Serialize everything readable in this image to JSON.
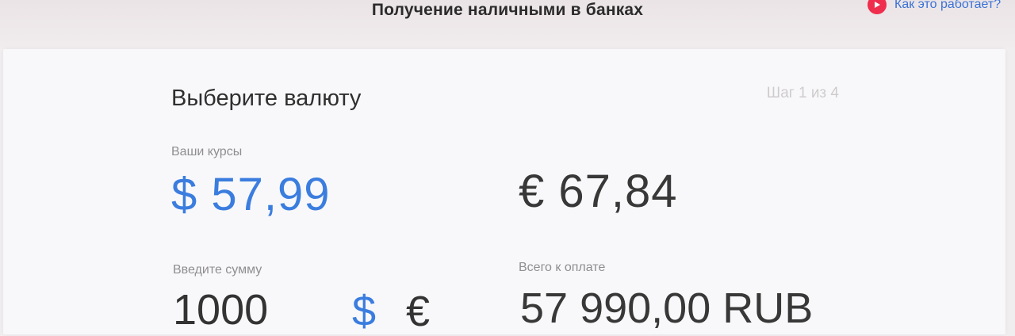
{
  "header": {
    "title": "Получение наличными в банках",
    "how_it_works": "Как это работает?",
    "play_icon": "play-icon",
    "play_color": "#ef2d4d"
  },
  "form": {
    "heading": "Выберите валюту",
    "step": "Шаг 1 из 4",
    "rates_label": "Ваши курсы",
    "rate_usd": "$ 57,99",
    "rate_eur": "€ 67,84",
    "amount_label": "Введите сумму",
    "amount_value": "1000",
    "currency_usd": "$",
    "currency_eur": "€",
    "selected_currency": "USD",
    "total_label": "Всего к оплате",
    "total_value": "57 990,00 RUB"
  },
  "colors": {
    "accent": "#3b7ddf",
    "text": "#383838",
    "muted": "#8f8d90"
  }
}
